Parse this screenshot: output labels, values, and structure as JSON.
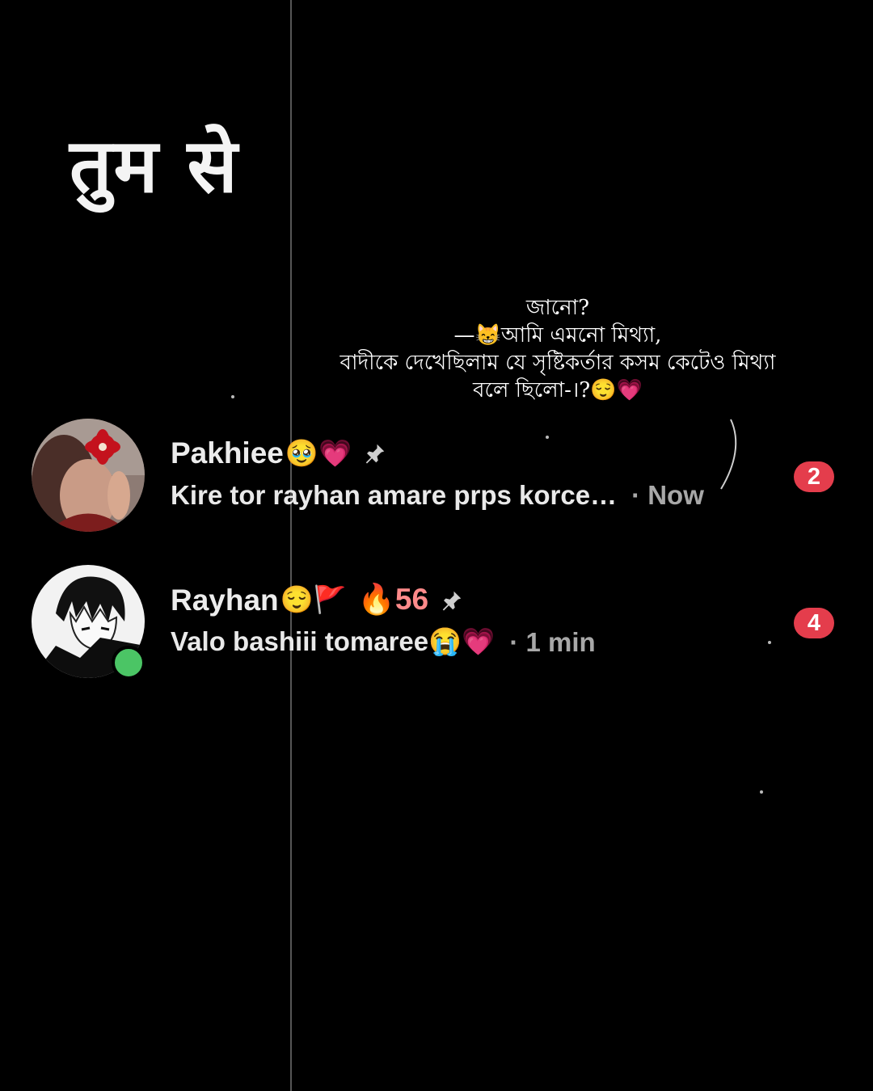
{
  "overlay": {
    "title": "तुम से",
    "quote_lines": [
      "জানো?",
      "—😸আমি এমনো মিথ্যা,",
      "বাদীকে দেখেছিলাম যে সৃষ্টিকর্তার কসম কেটেও মিথ্যা",
      "বলে ছিলো-।?😌💗"
    ]
  },
  "chats": [
    {
      "name": "Pakhiee",
      "name_emojis": "🥹💗",
      "pinned": true,
      "streak": "",
      "message": "Kire tor rayhan amare prps korce…",
      "time": "· Now",
      "unread": "2",
      "online": false,
      "avatar_icon": "profile-photo-woman-with-red-flower"
    },
    {
      "name": "Rayhan",
      "name_emojis": "😌🚩",
      "pinned": true,
      "streak": "🔥56",
      "message": "Valo bashiii tomaree😭💗",
      "time": "· 1 min",
      "unread": "4",
      "online": true,
      "avatar_icon": "profile-anime-boy-illustration"
    }
  ],
  "colors": {
    "background": "#000000",
    "badge": "#e43d4c",
    "online": "#4bc565",
    "streak": "#ff8a8a",
    "time": "#a8a8a8"
  }
}
